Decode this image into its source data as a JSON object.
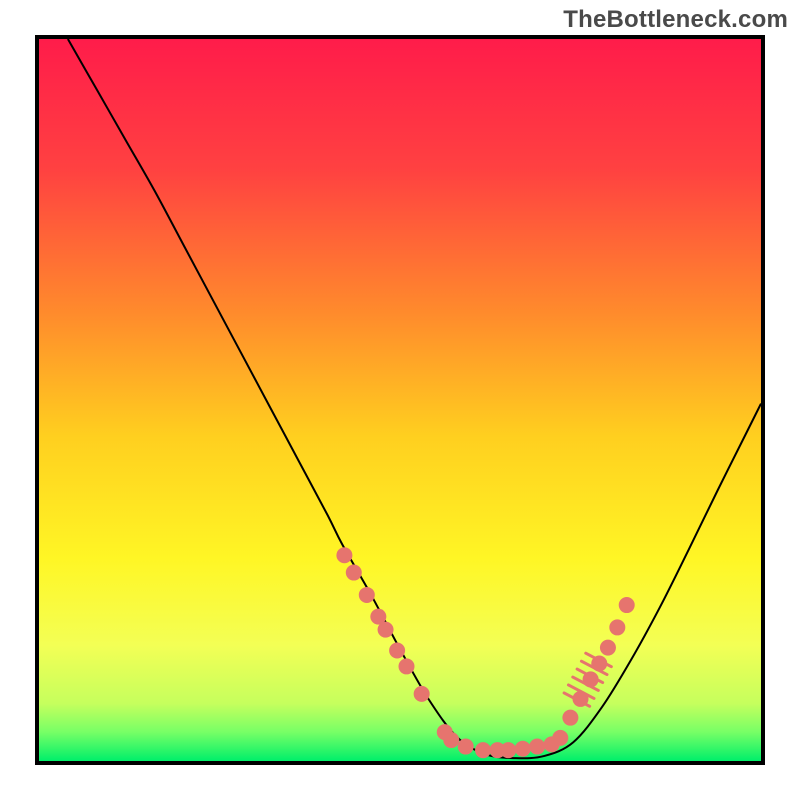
{
  "watermark": "TheBottleneck.com",
  "plot": {
    "border_color": "#000000",
    "gradient": {
      "stops": [
        {
          "offset": 0.0,
          "color": "#ff1c4a"
        },
        {
          "offset": 0.18,
          "color": "#ff4141"
        },
        {
          "offset": 0.38,
          "color": "#ff8b2c"
        },
        {
          "offset": 0.55,
          "color": "#ffcf1f"
        },
        {
          "offset": 0.72,
          "color": "#fff625"
        },
        {
          "offset": 0.84,
          "color": "#f3ff55"
        },
        {
          "offset": 0.92,
          "color": "#c6ff5d"
        },
        {
          "offset": 0.96,
          "color": "#77ff66"
        },
        {
          "offset": 1.0,
          "color": "#00ef6a"
        }
      ]
    }
  },
  "chart_data": {
    "type": "line",
    "title": "",
    "xlabel": "",
    "ylabel": "",
    "xlim": [
      0,
      100
    ],
    "ylim": [
      0,
      100
    ],
    "series": [
      {
        "name": "curve",
        "color": "#000000",
        "stroke_width": 2,
        "x": [
          4,
          8,
          12,
          16,
          20,
          24,
          28,
          32,
          36,
          40,
          42,
          46,
          50,
          54,
          58,
          62,
          66,
          70,
          74,
          78,
          82,
          86,
          90,
          94,
          98,
          100
        ],
        "y": [
          100,
          93,
          86,
          79,
          71.5,
          64,
          56.5,
          49,
          41.5,
          34,
          30,
          23,
          15.5,
          8.5,
          3.2,
          0.9,
          0.4,
          0.7,
          2.6,
          7.5,
          14,
          21.3,
          29.3,
          37.5,
          45.5,
          49.5
        ]
      }
    ],
    "markers": {
      "name": "trough-markers",
      "color": "#e6746e",
      "radius": 8,
      "points": [
        {
          "x": 42.3,
          "y": 28.5
        },
        {
          "x": 43.6,
          "y": 26.1
        },
        {
          "x": 45.4,
          "y": 23.0
        },
        {
          "x": 47.0,
          "y": 20.0
        },
        {
          "x": 48.0,
          "y": 18.2
        },
        {
          "x": 49.6,
          "y": 15.3
        },
        {
          "x": 50.9,
          "y": 13.1
        },
        {
          "x": 53.0,
          "y": 9.3
        },
        {
          "x": 56.2,
          "y": 4.0
        },
        {
          "x": 57.1,
          "y": 2.9
        },
        {
          "x": 59.1,
          "y": 2.0
        },
        {
          "x": 61.5,
          "y": 1.5
        },
        {
          "x": 63.5,
          "y": 1.5
        },
        {
          "x": 65.0,
          "y": 1.5
        },
        {
          "x": 67.0,
          "y": 1.7
        },
        {
          "x": 69.0,
          "y": 2.0
        },
        {
          "x": 71.0,
          "y": 2.3
        },
        {
          "x": 72.2,
          "y": 3.2
        },
        {
          "x": 73.6,
          "y": 6.0
        },
        {
          "x": 75.0,
          "y": 8.6
        },
        {
          "x": 76.4,
          "y": 11.3
        },
        {
          "x": 77.6,
          "y": 13.5
        },
        {
          "x": 78.8,
          "y": 15.7
        },
        {
          "x": 80.1,
          "y": 18.5
        },
        {
          "x": 81.4,
          "y": 21.6
        }
      ]
    },
    "ticks_top_right": {
      "x": [
        74.5,
        75.1,
        75.7,
        76.3,
        76.9,
        77.5
      ],
      "y": [
        8.5,
        9.6,
        10.7,
        11.8,
        12.9,
        14.0
      ],
      "length": 2.0,
      "color": "#e6746e"
    }
  }
}
